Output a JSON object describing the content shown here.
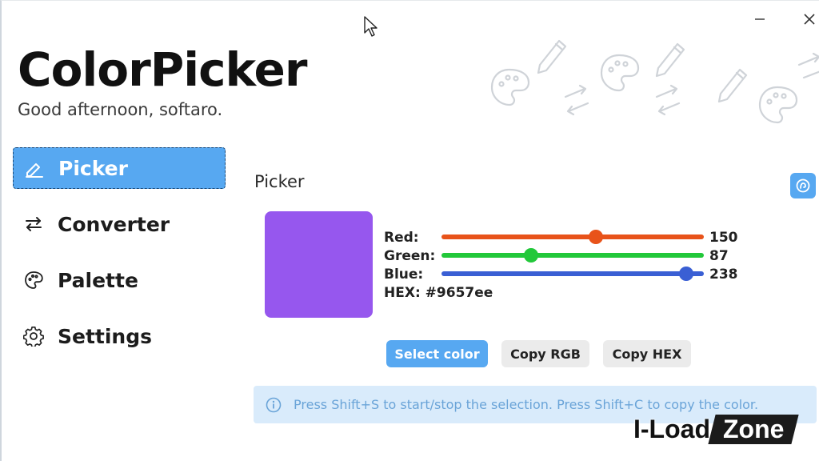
{
  "window": {
    "minimize_label": "–",
    "close_label": "✕"
  },
  "app": {
    "title": "ColorPicker",
    "greeting": "Good afternoon, softaro."
  },
  "sidebar": {
    "items": [
      {
        "label": "Picker",
        "icon": "pen-icon",
        "active": true
      },
      {
        "label": "Converter",
        "icon": "arrows-swap-icon",
        "active": false
      },
      {
        "label": "Palette",
        "icon": "palette-icon",
        "active": false
      },
      {
        "label": "Settings",
        "icon": "gear-icon",
        "active": false
      }
    ]
  },
  "picker": {
    "page_title": "Picker",
    "swatch_color": "#9657ee",
    "red": {
      "label": "Red:",
      "value": "150",
      "color": "#e8531a",
      "fraction": 0.588
    },
    "green": {
      "label": "Green:",
      "value": "87",
      "color": "#22c83a",
      "fraction": 0.341
    },
    "blue": {
      "label": "Blue:",
      "value": "238",
      "color": "#3a5fd4",
      "fraction": 0.933
    },
    "hex_label": "HEX: #9657ee",
    "buttons": {
      "select": "Select color",
      "copy_rgb": "Copy RGB",
      "copy_hex": "Copy HEX"
    },
    "info": "Press Shift+S to start/stop the selection. Press Shift+C to copy the color."
  },
  "watermark": {
    "left": "I-Load",
    "right": "Zone"
  },
  "colors": {
    "accent": "#57a8f1",
    "info_bg": "#d9ebfb",
    "info_text": "#6aa4d8"
  }
}
